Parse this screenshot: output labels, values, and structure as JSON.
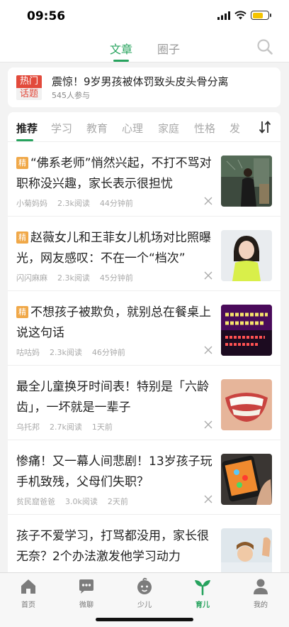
{
  "status_bar": {
    "time": "09:56",
    "battery_level": 0.7
  },
  "top_nav": {
    "tabs": [
      {
        "label": "文章",
        "active": true
      },
      {
        "label": "圈子",
        "active": false
      }
    ],
    "search_icon": "search-icon"
  },
  "hot_topic": {
    "badge_top": "热门",
    "badge_bottom": "话题",
    "title": "震惊！9岁男孩被体罚致头皮头骨分离",
    "participants": "545人参与"
  },
  "categories": {
    "items": [
      "推荐",
      "学习",
      "教育",
      "心理",
      "家庭",
      "性格",
      "发"
    ],
    "active_index": 0,
    "sort_icon": "sort-arrows-icon"
  },
  "articles": [
    {
      "featured": true,
      "badge": "精",
      "title": "“佛系老师”悄然兴起，不打不骂对职称没兴趣，家长表示很担忧",
      "author": "小菊妈妈",
      "reads": "2.3k阅读",
      "time": "44分钟前"
    },
    {
      "featured": true,
      "badge": "精",
      "title": "赵薇女儿和王菲女儿机场对比照曝光，网友感叹：不在一个“档次”",
      "author": "闪闪麻麻",
      "reads": "2.3k阅读",
      "time": "45分钟前"
    },
    {
      "featured": true,
      "badge": "精",
      "title": "不想孩子被欺负，就别总在餐桌上说这句话",
      "author": "咕咕妈",
      "reads": "2.3k阅读",
      "time": "46分钟前",
      "thumb_text": "は食べちゃダメ」と れた子はいじめられ 家长教育“说不该吃”的小孩 容易被人欺负？"
    },
    {
      "featured": false,
      "title": "最全儿童换牙时间表！特别是「六龄齿」，一坏就是一辈子",
      "author": "乌托邦",
      "reads": "2.7k阅读",
      "time": "1天前"
    },
    {
      "featured": false,
      "title": "惨痛！又一幕人间悲剧！13岁孩子玩手机致残，父母们失职？",
      "author": "贫民窟爸爸",
      "reads": "3.0k阅读",
      "time": "2天前"
    },
    {
      "featured": false,
      "title": "孩子不爱学习，打骂都没用，家长很无奈？2个办法激发他学习动力",
      "author": "",
      "reads": "",
      "time": ""
    }
  ],
  "bottom_nav": {
    "items": [
      {
        "label": "首页",
        "icon": "home-icon"
      },
      {
        "label": "微聊",
        "icon": "chat-icon"
      },
      {
        "label": "少儿",
        "icon": "child-face-icon"
      },
      {
        "label": "育儿",
        "icon": "sprout-icon",
        "active": true
      },
      {
        "label": "我的",
        "icon": "person-icon"
      }
    ]
  },
  "colors": {
    "accent": "#27a35e",
    "hot_red": "#e24a3b",
    "featured_badge": "#f0a848"
  }
}
